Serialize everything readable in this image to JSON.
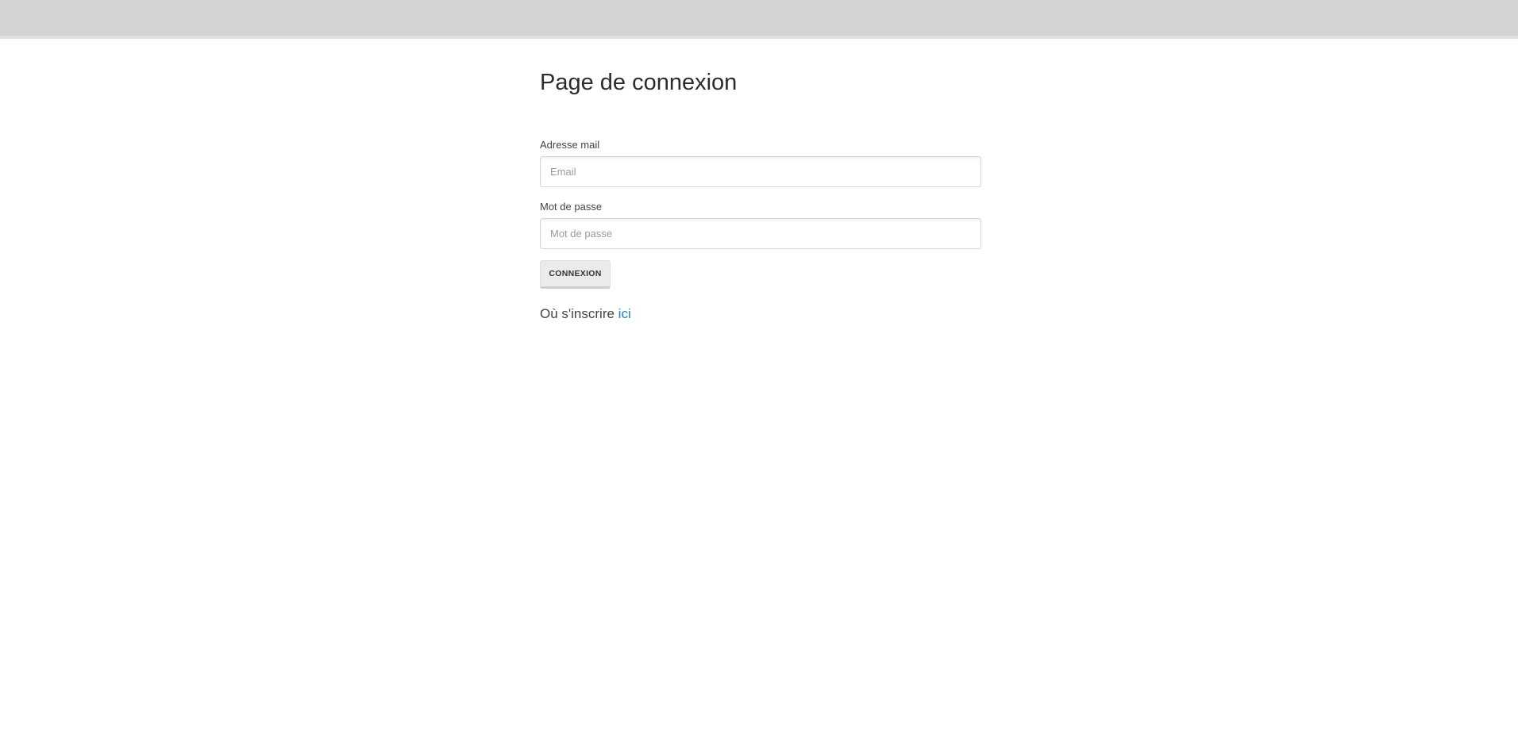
{
  "page": {
    "title": "Page de connexion"
  },
  "form": {
    "email_label": "Adresse mail",
    "email_placeholder": "Email",
    "email_value": "",
    "password_label": "Mot de passe",
    "password_placeholder": "Mot de passe",
    "password_value": "",
    "submit_label": "CONNEXION"
  },
  "register": {
    "prefix": "Où s'inscrire",
    "link_text": "ici"
  },
  "colors": {
    "topbar": "#d3d3d3",
    "link": "#2a7fc0",
    "button": "#ebebeb"
  }
}
